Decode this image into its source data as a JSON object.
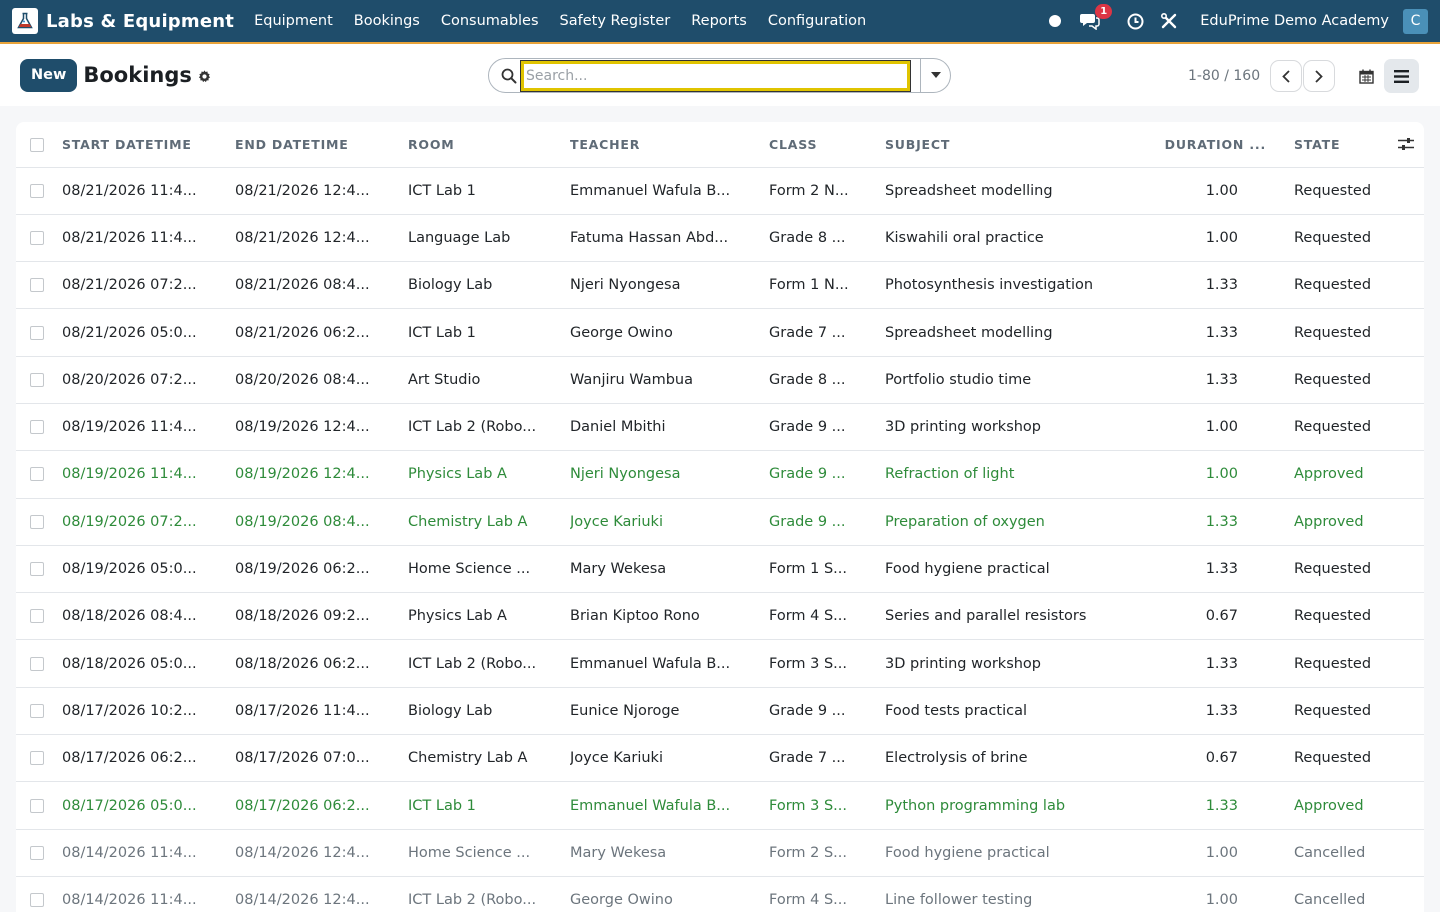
{
  "navbar": {
    "app_name": "Labs & Equipment",
    "menu": [
      "Equipment",
      "Bookings",
      "Consumables",
      "Safety Register",
      "Reports",
      "Configuration"
    ],
    "message_count": "1",
    "company": "EduPrime Demo Academy",
    "user_initial": "C"
  },
  "control": {
    "new_label": "New",
    "title": "Bookings",
    "search_placeholder": "Search...",
    "pager": "1-80 / 160"
  },
  "columns": [
    "START DATETIME",
    "END DATETIME",
    "ROOM",
    "TEACHER",
    "CLASS",
    "SUBJECT",
    "DURATION ...",
    "STATE"
  ],
  "colors": {
    "approved": "#2e8b3a",
    "cancelled": "#6c757d",
    "brand": "#1f4d6b",
    "accent": "#e8a33a"
  },
  "rows": [
    {
      "start": "08/21/2026 11:4...",
      "end": "08/21/2026 12:4...",
      "room": "ICT Lab 1",
      "teacher": "Emmanuel Wafula B...",
      "cls": "Form 2 N...",
      "subject": "Spreadsheet modelling",
      "duration": "1.00",
      "state": "Requested"
    },
    {
      "start": "08/21/2026 11:4...",
      "end": "08/21/2026 12:4...",
      "room": "Language Lab",
      "teacher": "Fatuma Hassan Abd...",
      "cls": "Grade 8 ...",
      "subject": "Kiswahili oral practice",
      "duration": "1.00",
      "state": "Requested"
    },
    {
      "start": "08/21/2026 07:2...",
      "end": "08/21/2026 08:4...",
      "room": "Biology Lab",
      "teacher": "Njeri Nyongesa",
      "cls": "Form 1 N...",
      "subject": "Photosynthesis investigation",
      "duration": "1.33",
      "state": "Requested"
    },
    {
      "start": "08/21/2026 05:0...",
      "end": "08/21/2026 06:2...",
      "room": "ICT Lab 1",
      "teacher": "George Owino",
      "cls": "Grade 7 ...",
      "subject": "Spreadsheet modelling",
      "duration": "1.33",
      "state": "Requested"
    },
    {
      "start": "08/20/2026 07:2...",
      "end": "08/20/2026 08:4...",
      "room": "Art Studio",
      "teacher": "Wanjiru Wambua",
      "cls": "Grade 8 ...",
      "subject": "Portfolio studio time",
      "duration": "1.33",
      "state": "Requested"
    },
    {
      "start": "08/19/2026 11:4...",
      "end": "08/19/2026 12:4...",
      "room": "ICT Lab 2 (Robo...",
      "teacher": "Daniel Mbithi",
      "cls": "Grade 9 ...",
      "subject": "3D printing workshop",
      "duration": "1.00",
      "state": "Requested"
    },
    {
      "start": "08/19/2026 11:4...",
      "end": "08/19/2026 12:4...",
      "room": "Physics Lab A",
      "teacher": "Njeri Nyongesa",
      "cls": "Grade 9 ...",
      "subject": "Refraction of light",
      "duration": "1.00",
      "state": "Approved"
    },
    {
      "start": "08/19/2026 07:2...",
      "end": "08/19/2026 08:4...",
      "room": "Chemistry Lab A",
      "teacher": "Joyce Kariuki",
      "cls": "Grade 9 ...",
      "subject": "Preparation of oxygen",
      "duration": "1.33",
      "state": "Approved"
    },
    {
      "start": "08/19/2026 05:0...",
      "end": "08/19/2026 06:2...",
      "room": "Home Science ...",
      "teacher": "Mary Wekesa",
      "cls": "Form 1 S...",
      "subject": "Food hygiene practical",
      "duration": "1.33",
      "state": "Requested"
    },
    {
      "start": "08/18/2026 08:4...",
      "end": "08/18/2026 09:2...",
      "room": "Physics Lab A",
      "teacher": "Brian Kiptoo Rono",
      "cls": "Form 4 S...",
      "subject": "Series and parallel resistors",
      "duration": "0.67",
      "state": "Requested"
    },
    {
      "start": "08/18/2026 05:0...",
      "end": "08/18/2026 06:2...",
      "room": "ICT Lab 2 (Robo...",
      "teacher": "Emmanuel Wafula B...",
      "cls": "Form 3 S...",
      "subject": "3D printing workshop",
      "duration": "1.33",
      "state": "Requested"
    },
    {
      "start": "08/17/2026 10:2...",
      "end": "08/17/2026 11:4...",
      "room": "Biology Lab",
      "teacher": "Eunice Njoroge",
      "cls": "Grade 9 ...",
      "subject": "Food tests practical",
      "duration": "1.33",
      "state": "Requested"
    },
    {
      "start": "08/17/2026 06:2...",
      "end": "08/17/2026 07:0...",
      "room": "Chemistry Lab A",
      "teacher": "Joyce Kariuki",
      "cls": "Grade 7 ...",
      "subject": "Electrolysis of brine",
      "duration": "0.67",
      "state": "Requested"
    },
    {
      "start": "08/17/2026 05:0...",
      "end": "08/17/2026 06:2...",
      "room": "ICT Lab 1",
      "teacher": "Emmanuel Wafula B...",
      "cls": "Form 3 S...",
      "subject": "Python programming lab",
      "duration": "1.33",
      "state": "Approved"
    },
    {
      "start": "08/14/2026 11:4...",
      "end": "08/14/2026 12:4...",
      "room": "Home Science ...",
      "teacher": "Mary Wekesa",
      "cls": "Form 2 S...",
      "subject": "Food hygiene practical",
      "duration": "1.00",
      "state": "Cancelled"
    },
    {
      "start": "08/14/2026 11:4...",
      "end": "08/14/2026 12:4...",
      "room": "ICT Lab 2 (Robo...",
      "teacher": "George Owino",
      "cls": "Form 4 S...",
      "subject": "Line follower testing",
      "duration": "1.00",
      "state": "Cancelled"
    }
  ]
}
